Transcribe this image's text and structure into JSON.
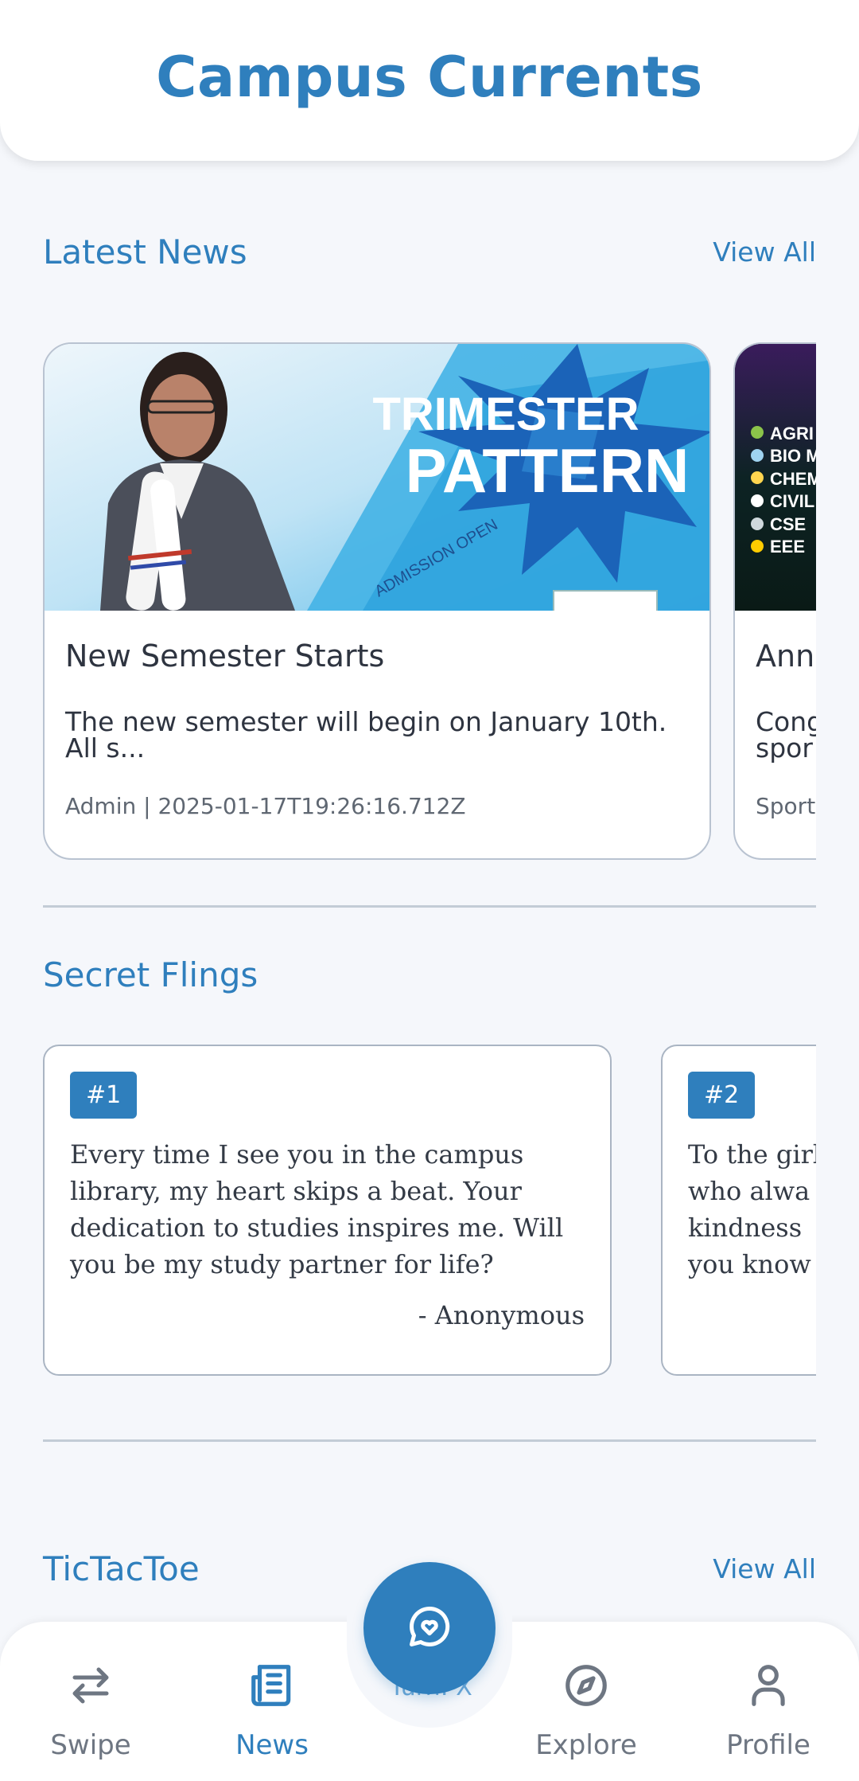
{
  "app": {
    "title": "Campus Currents"
  },
  "latest_news": {
    "title": "Latest News",
    "view_all": "View All",
    "cards": [
      {
        "title": "New Semester Starts",
        "excerpt_line1": "The new semester will begin on January 10th.",
        "excerpt_line2": "All s...",
        "meta": "Admin | 2025-01-17T19:26:16.712Z",
        "banner_line1": "TRIMESTER",
        "banner_line2": "PATTERN",
        "banner_small": "ADMISSION OPEN"
      },
      {
        "title": "Annu",
        "excerpt_line1": "Cong",
        "excerpt_line2": "spor",
        "meta": "Sport",
        "list": [
          "AGRI",
          "BIO M",
          "CHEM",
          "CIVIL",
          "CSE",
          "EEE"
        ]
      }
    ]
  },
  "secret_flings": {
    "title": "Secret Flings",
    "cards": [
      {
        "badge": "#1",
        "text": "Every time I see you in the campus library, my heart skips a beat. Your dedication to studies inspires me. Will you be my study partner for life?",
        "author": "- Anonymous"
      },
      {
        "badge": "#2",
        "line1": "To the girl",
        "line2": "who alwa",
        "line3": "kindness",
        "line4": "you know"
      }
    ]
  },
  "tictactoe": {
    "title": "TicTacToe",
    "view_all": "View All",
    "peek": "Turn: X"
  },
  "nav": {
    "items": [
      {
        "label": "Swipe",
        "icon": "swap-arrows-icon",
        "active": false
      },
      {
        "label": "News",
        "icon": "newspaper-icon",
        "active": true
      },
      {
        "label": "Explore",
        "icon": "compass-icon",
        "active": false
      },
      {
        "label": "Profile",
        "icon": "user-icon",
        "active": false
      }
    ],
    "fab_icon": "chat-heart-icon"
  },
  "colors": {
    "accent": "#2f7fbd",
    "background": "#f5f7fb",
    "muted": "#6e7682"
  }
}
